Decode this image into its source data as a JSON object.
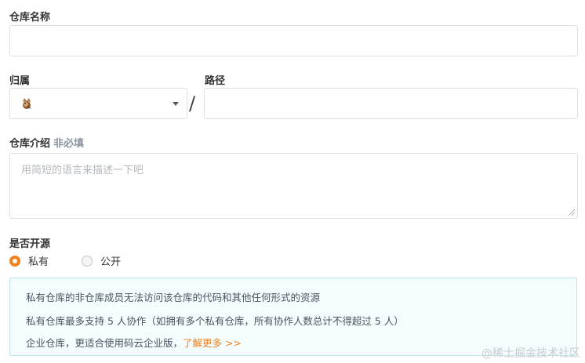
{
  "repo_name": {
    "label": "仓库名称",
    "value": ""
  },
  "owner": {
    "label": "归属",
    "avatar_icon": "fox-avatar-icon"
  },
  "separator": "/",
  "path": {
    "label": "路径",
    "value": ""
  },
  "description": {
    "label": "仓库介绍",
    "optional_tag": "非必填",
    "placeholder": "用简短的语言来描述一下吧"
  },
  "visibility": {
    "label": "是否开源",
    "options": [
      {
        "label": "私有",
        "selected": true
      },
      {
        "label": "公开",
        "selected": false
      }
    ]
  },
  "notice": {
    "line1": "私有仓库的非仓库成员无法访问该仓库的代码和其他任何形式的资源",
    "line2": "私有仓库最多支持 5 人协作（如拥有多个私有仓库，所有协作人数总计不得超过 5 人）",
    "line3_text": "企业仓库，更适合使用码云企业版，",
    "line3_link": "了解更多 >>"
  },
  "watermark": "@稀土掘金技术社区",
  "colors": {
    "accent": "#f0801f",
    "notice_bg": "#f4fcfd",
    "notice_border": "#bde5ea"
  }
}
